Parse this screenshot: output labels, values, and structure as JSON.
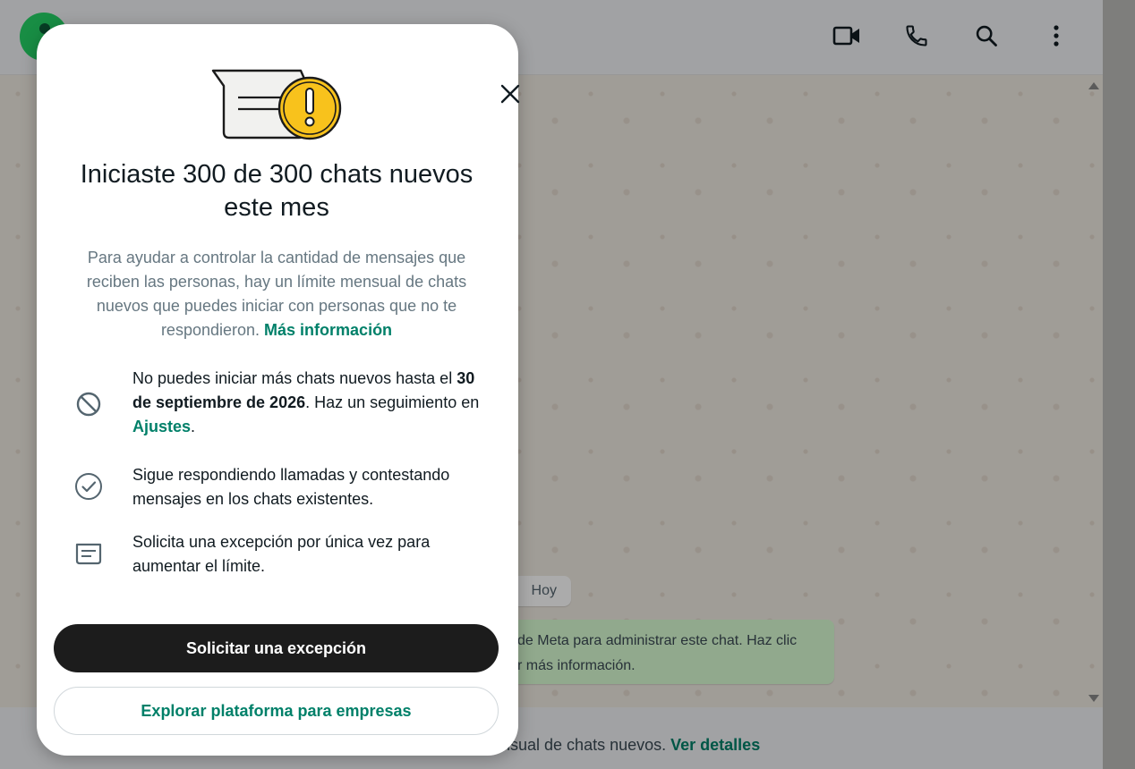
{
  "background": {
    "date_chip": "Hoy",
    "system_note_line1": "de Meta para administrar este chat. Haz clic",
    "system_note_line2": "r más información.",
    "bottom_text": "nsual de chats nuevos.",
    "bottom_link": "Ver detalles"
  },
  "header_icons": [
    "video-call-icon",
    "voice-call-icon",
    "search-icon",
    "more-options-icon"
  ],
  "modal": {
    "title": "Iniciaste 300 de 300 chats nuevos este mes",
    "description": "Para ayudar a controlar la cantidad de mensajes que reciben las personas, hay un límite mensual de chats nuevos que puedes iniciar con personas que no te respondieron.",
    "description_link": "Más información",
    "feature1_pre": "No puedes iniciar más chats nuevos hasta el",
    "feature1_date": "30 de septiembre de 2026",
    "feature1_mid": ". Haz un seguimiento en",
    "feature1_link": "Ajustes",
    "feature1_end": ".",
    "feature2": "Sigue respondiendo llamadas y contestando mensajes en los chats existentes.",
    "feature3": "Solicita una excepción por única vez para aumentar el límite.",
    "primary_button": "Solicitar una excepción",
    "secondary_button": "Explorar plataforma para empresas"
  },
  "colors": {
    "accent_green": "#008069",
    "primary_button_bg": "#1c1c1c",
    "warning_yellow": "#f8c21c"
  }
}
